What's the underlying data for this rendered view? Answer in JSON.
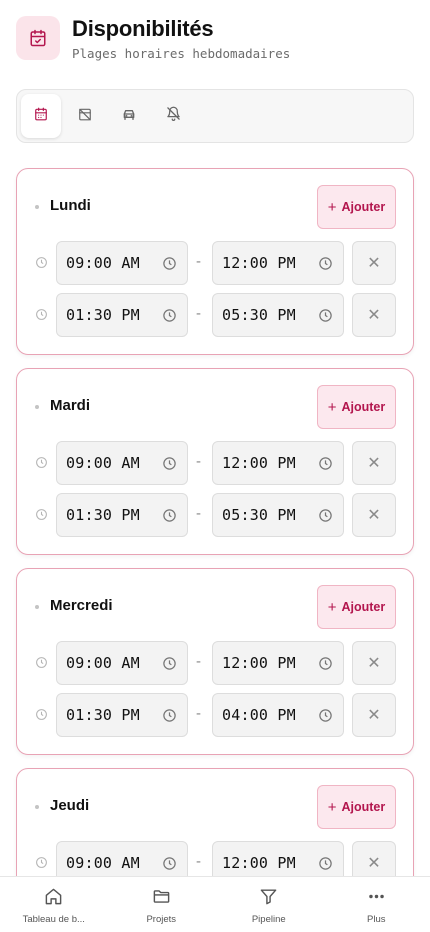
{
  "header": {
    "title": "Disponibilités",
    "subtitle": "Plages horaires hebdomadaires",
    "icon": "calendar-check-icon"
  },
  "toolbar": {
    "items": [
      {
        "icon": "calendar-icon",
        "active": true
      },
      {
        "icon": "calendar-off-icon",
        "active": false
      },
      {
        "icon": "car-icon",
        "active": false
      },
      {
        "icon": "bell-off-icon",
        "active": false
      }
    ]
  },
  "colors": {
    "accent": "#b3164e",
    "accent_light": "#fce8ee",
    "card_border": "#e8a3b5"
  },
  "add_label": "Ajouter",
  "separator": "-",
  "days": [
    {
      "name": "Lundi",
      "slots": [
        {
          "start": "09:00 AM",
          "end": "12:00 PM"
        },
        {
          "start": "01:30 PM",
          "end": "05:30 PM"
        }
      ]
    },
    {
      "name": "Mardi",
      "slots": [
        {
          "start": "09:00 AM",
          "end": "12:00 PM"
        },
        {
          "start": "01:30 PM",
          "end": "05:30 PM"
        }
      ]
    },
    {
      "name": "Mercredi",
      "slots": [
        {
          "start": "09:00 AM",
          "end": "12:00 PM"
        },
        {
          "start": "01:30 PM",
          "end": "04:00 PM"
        }
      ]
    },
    {
      "name": "Jeudi",
      "slots": [
        {
          "start": "09:00 AM",
          "end": "12:00 PM"
        }
      ]
    }
  ],
  "bottom_nav": [
    {
      "label": "Tableau de b...",
      "icon": "home-icon"
    },
    {
      "label": "Projets",
      "icon": "folder-icon"
    },
    {
      "label": "Pipeline",
      "icon": "filter-icon"
    },
    {
      "label": "Plus",
      "icon": "more-icon"
    }
  ]
}
